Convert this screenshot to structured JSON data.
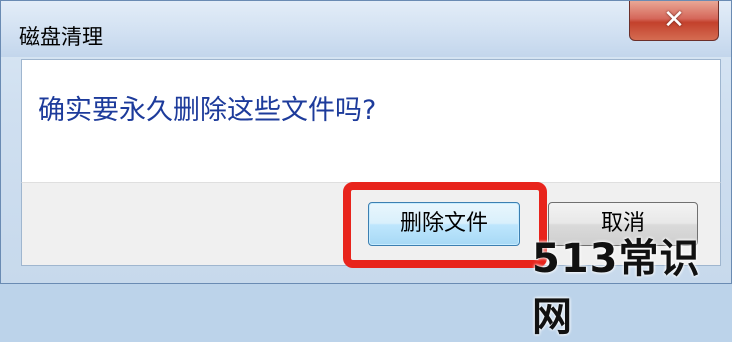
{
  "window": {
    "title": "磁盘清理",
    "close_label": "✕"
  },
  "dialog": {
    "message": "确实要永久删除这些文件吗?"
  },
  "buttons": {
    "delete_label": "删除文件",
    "cancel_label": "取消"
  },
  "annotation": {
    "highlight_color": "#e8241c"
  },
  "watermark": {
    "text": "513常识网"
  }
}
